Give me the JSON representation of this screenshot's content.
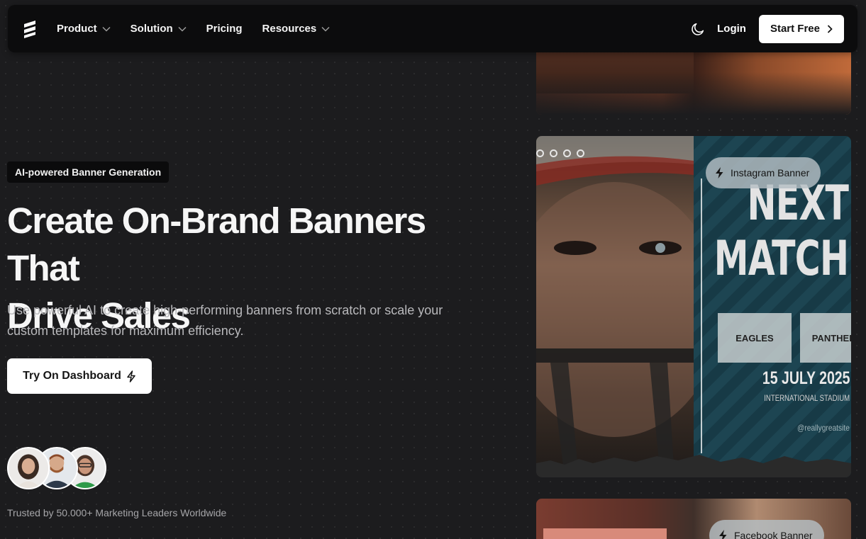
{
  "nav": {
    "items": [
      {
        "label": "Product",
        "dropdown": true
      },
      {
        "label": "Solution",
        "dropdown": true
      },
      {
        "label": "Pricing",
        "dropdown": false
      },
      {
        "label": "Resources",
        "dropdown": true
      }
    ],
    "login": "Login",
    "cta": "Start Free"
  },
  "hero": {
    "badge": "AI-powered Banner Generation",
    "title_line1": "Create On-Brand Banners That",
    "title_line2": "Drive Sales",
    "subtitle": "Use powerful AI to create high-performing banners from scratch or scale your custom templates for maximum efficiency.",
    "cta": "Try On Dashboard",
    "trusted": "Trusted by 50.000+ Marketing Leaders Worldwide"
  },
  "showcase": {
    "instagram_label": "Instagram Banner",
    "facebook_label": "Facebook Banner",
    "banner": {
      "line1": "NEXT",
      "line2": "MATCH",
      "team1": "EAGLES",
      "team2": "PANTHERS",
      "date": "15 JULY 2025",
      "venue": "INTERNATIONAL STADIUM",
      "handle": "@reallygreatsite"
    }
  },
  "colors": {
    "background": "#1c1c1e",
    "navbar": "#0c0c0d",
    "button": "#ffffff",
    "text_muted": "#b9b9bc"
  }
}
